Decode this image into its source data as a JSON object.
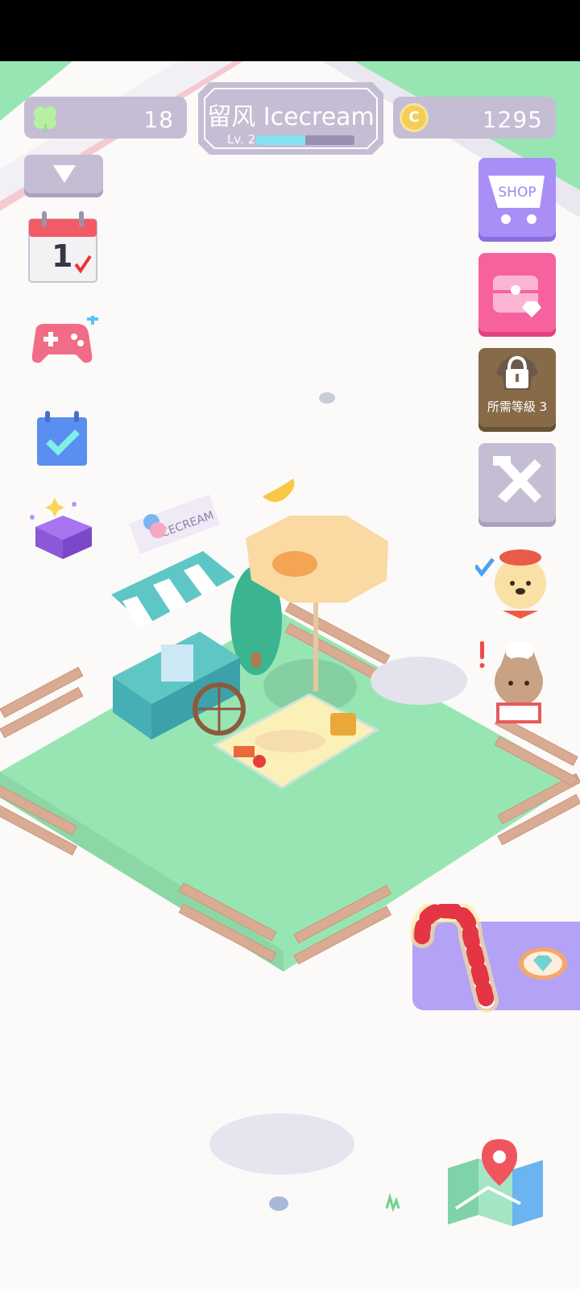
{
  "hud": {
    "clover_count": "18",
    "coin_count": "1295",
    "shop_title": "留风 Icecream",
    "level_label": "Lv. 2",
    "level_progress": 0.5
  },
  "calendar": {
    "day": "1"
  },
  "right_menu": {
    "shop_label": "SHOP",
    "locked_label": "所需等級 3"
  },
  "scene": {
    "cart_sign": "ICECREAM"
  },
  "colors": {
    "grass": "#98e5b4",
    "hud_pill": "#c4bdd4",
    "shop_purple": "#a98ef6",
    "chest_pink": "#f7629e",
    "locked_brown": "#876a48",
    "event_panel": "#b3a2f5"
  },
  "icons": [
    "clover-icon",
    "coin-icon",
    "calendar-icon",
    "gamepad-icon",
    "checklist-icon",
    "gift-box-icon",
    "shopping-cart-icon",
    "treasure-chest-icon",
    "lock-icon",
    "tools-icon",
    "candy-cane-icon",
    "diamond-icon",
    "map-icon"
  ]
}
